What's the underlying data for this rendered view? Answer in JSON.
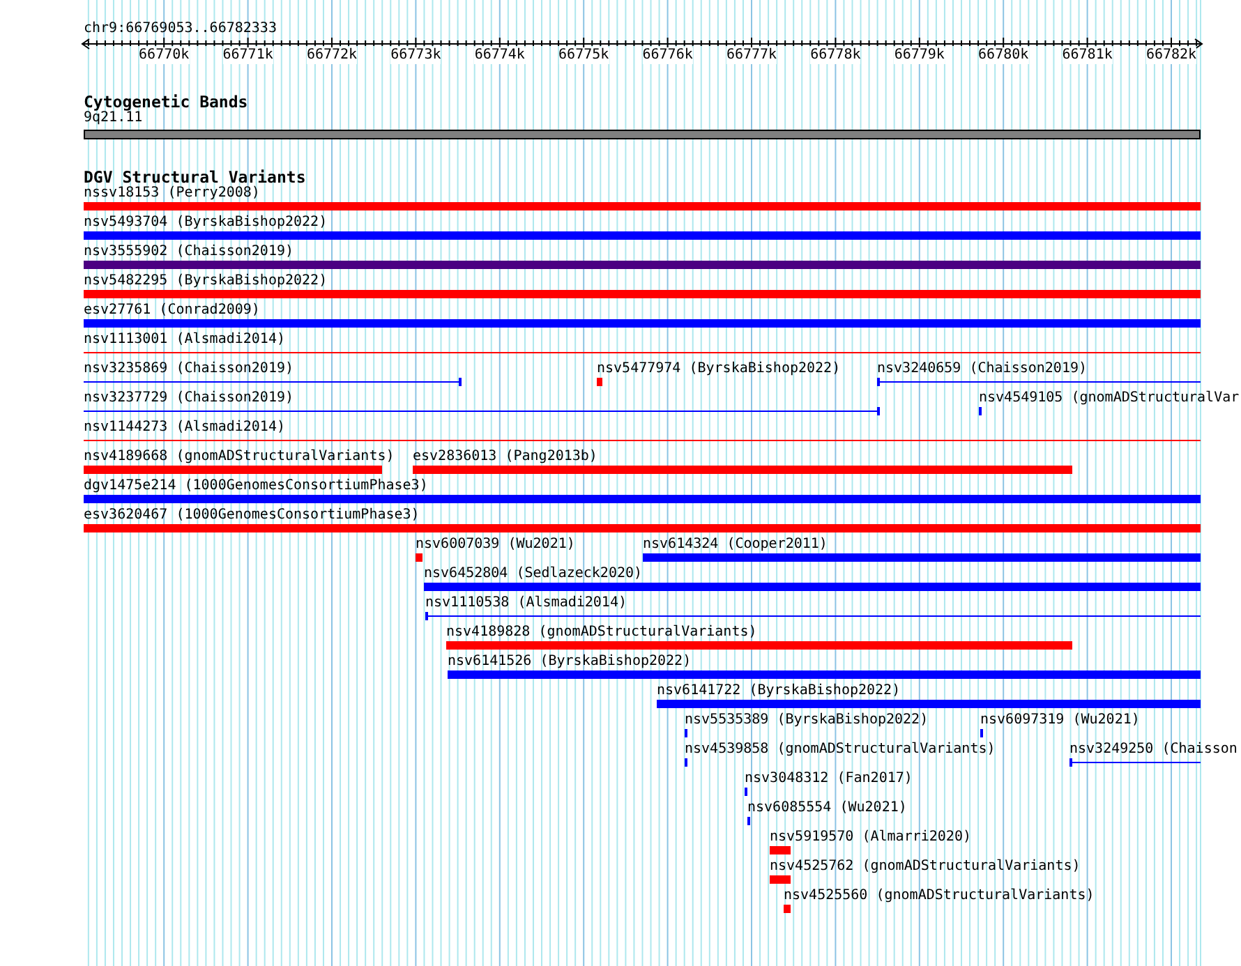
{
  "ruler": {
    "location": "chr9:66769053..66782333",
    "ticks": [
      "66770k",
      "66771k",
      "66772k",
      "66773k",
      "66774k",
      "66775k",
      "66776k",
      "66777k",
      "66778k",
      "66779k",
      "66780k",
      "66781k",
      "66782k"
    ]
  },
  "cytoband_track": {
    "title": "Cytogenetic Bands",
    "bands": [
      {
        "label": "9q21.11"
      }
    ]
  },
  "variant_track": {
    "title": "DGV Structural Variants",
    "rows": [
      {
        "features": [
          {
            "label": "nssv18153 (Perry2008)",
            "kind": "bar",
            "color": "#ff0000"
          }
        ]
      },
      {
        "features": [
          {
            "label": "nsv5493704 (ByrskaBishop2022)",
            "kind": "bar",
            "color": "#0000ff"
          }
        ]
      },
      {
        "features": [
          {
            "label": "nsv3555902 (Chaisson2019)",
            "kind": "bar",
            "color": "#4b0082"
          }
        ]
      },
      {
        "features": [
          {
            "label": "nsv5482295 (ByrskaBishop2022)",
            "kind": "bar",
            "color": "#ff0000"
          }
        ]
      },
      {
        "features": [
          {
            "label": "esv27761 (Conrad2009)",
            "kind": "bar",
            "color": "#0000ff"
          }
        ]
      },
      {
        "features": [
          {
            "label": "nsv1113001 (Alsmadi2014)",
            "kind": "line",
            "color": "#ff0000"
          }
        ]
      },
      {
        "features": [
          {
            "label": "nsv3235869 (Chaisson2019)",
            "kind": "line",
            "color": "#0000ff"
          },
          {
            "label": "nsv5477974 (ByrskaBishop2022)",
            "kind": "bar",
            "color": "#ff0000"
          },
          {
            "label": "nsv3240659 (Chaisson2019)",
            "kind": "line",
            "color": "#0000ff"
          }
        ]
      },
      {
        "features": [
          {
            "label": "nsv3237729 (Chaisson2019)",
            "kind": "line",
            "color": "#0000ff"
          },
          {
            "label": "nsv4549105 (gnomADStructuralVar",
            "kind": "line",
            "color": "#0000ff"
          }
        ]
      },
      {
        "features": [
          {
            "label": "nsv1144273 (Alsmadi2014)",
            "kind": "line",
            "color": "#ff0000"
          }
        ]
      },
      {
        "features": [
          {
            "label": "nsv4189668 (gnomADStructuralVariants)",
            "kind": "bar",
            "color": "#ff0000"
          },
          {
            "label": "esv2836013 (Pang2013b)",
            "kind": "bar",
            "color": "#ff0000"
          }
        ]
      },
      {
        "features": [
          {
            "label": "dgv1475e214 (1000GenomesConsortiumPhase3)",
            "kind": "bar",
            "color": "#0000ff"
          }
        ]
      },
      {
        "features": [
          {
            "label": "esv3620467 (1000GenomesConsortiumPhase3)",
            "kind": "bar",
            "color": "#ff0000"
          }
        ]
      },
      {
        "features": [
          {
            "label": "nsv6007039 (Wu2021)",
            "kind": "bar",
            "color": "#ff0000"
          },
          {
            "label": "nsv614324 (Cooper2011)",
            "kind": "bar",
            "color": "#0000ff"
          }
        ]
      },
      {
        "features": [
          {
            "label": "nsv6452804 (Sedlazeck2020)",
            "kind": "bar",
            "color": "#0000ff"
          }
        ]
      },
      {
        "features": [
          {
            "label": "nsv1110538 (Alsmadi2014)",
            "kind": "line",
            "color": "#0000ff"
          }
        ]
      },
      {
        "features": [
          {
            "label": "nsv4189828 (gnomADStructuralVariants)",
            "kind": "bar",
            "color": "#ff0000"
          }
        ]
      },
      {
        "features": [
          {
            "label": "nsv6141526 (ByrskaBishop2022)",
            "kind": "bar",
            "color": "#0000ff"
          }
        ]
      },
      {
        "features": [
          {
            "label": "nsv6141722 (ByrskaBishop2022)",
            "kind": "bar",
            "color": "#0000ff"
          }
        ]
      },
      {
        "features": [
          {
            "label": "nsv5535389 (ByrskaBishop2022)",
            "kind": "line",
            "color": "#0000ff"
          },
          {
            "label": "nsv6097319 (Wu2021)",
            "kind": "line",
            "color": "#0000ff"
          }
        ]
      },
      {
        "features": [
          {
            "label": "nsv4539858 (gnomADStructuralVariants)",
            "kind": "line",
            "color": "#0000ff"
          },
          {
            "label": "nsv3249250 (Chaisson",
            "kind": "line",
            "color": "#0000ff"
          }
        ]
      },
      {
        "features": [
          {
            "label": "nsv3048312 (Fan2017)",
            "kind": "line",
            "color": "#0000ff"
          }
        ]
      },
      {
        "features": [
          {
            "label": "nsv6085554 (Wu2021)",
            "kind": "line",
            "color": "#0000ff"
          }
        ]
      },
      {
        "features": [
          {
            "label": "nsv5919570 (Almarri2020)",
            "kind": "bar",
            "color": "#ff0000"
          }
        ]
      },
      {
        "features": [
          {
            "label": "nsv4525762 (gnomADStructuralVariants)",
            "kind": "bar",
            "color": "#ff0000"
          }
        ]
      },
      {
        "features": [
          {
            "label": "nsv4525560 (gnomADStructuralVariants)",
            "kind": "bar",
            "color": "#ff0000"
          }
        ]
      }
    ]
  }
}
